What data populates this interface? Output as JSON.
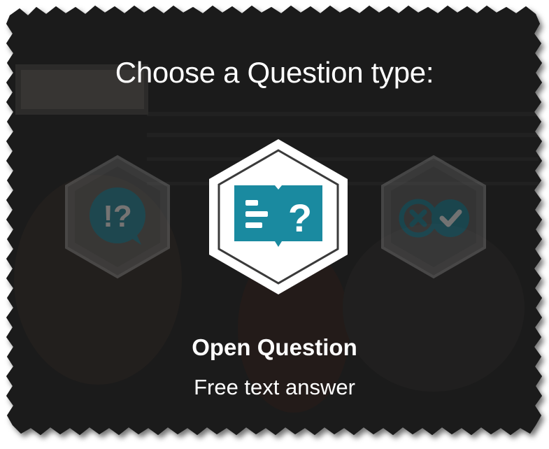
{
  "dialog": {
    "title": "Choose a Question type:",
    "selected_option": {
      "name": "Open Question",
      "description": "Free text answer"
    },
    "options": [
      {
        "icon": "exclamation-question-speech-bubble-icon",
        "selected": false
      },
      {
        "icon": "open-book-question-icon",
        "selected": true
      },
      {
        "icon": "cross-check-circles-icon",
        "selected": false
      }
    ]
  },
  "colors": {
    "accent": "#1a8aa0",
    "panel_bg": "#1e1e1e",
    "text": "#ffffff"
  }
}
